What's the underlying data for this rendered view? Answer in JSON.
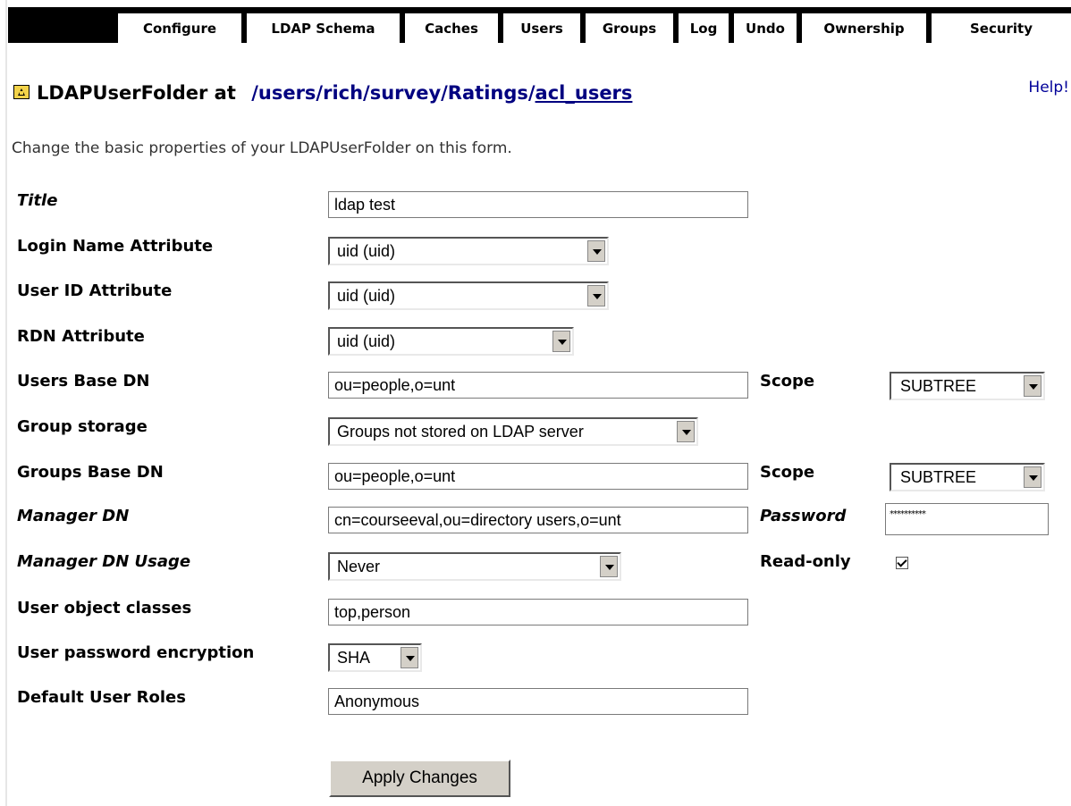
{
  "tabs": [
    {
      "label": "Configure",
      "active": true
    },
    {
      "label": "LDAP Schema"
    },
    {
      "label": "Caches"
    },
    {
      "label": "Users"
    },
    {
      "label": "Groups"
    },
    {
      "label": "Log"
    },
    {
      "label": "Undo"
    },
    {
      "label": "Ownership"
    },
    {
      "label": "Security"
    }
  ],
  "header": {
    "prefix": "LDAPUserFolder at",
    "path_plain": "/users/rich/survey/Ratings/",
    "path_link": "acl_users",
    "help": "Help!"
  },
  "intro": "Change the basic properties of your LDAPUserFolder on this form.",
  "form": {
    "title": {
      "label": "Title",
      "value": "ldap test"
    },
    "login_name_attribute": {
      "label": "Login Name Attribute",
      "value": "uid (uid)"
    },
    "user_id_attribute": {
      "label": "User ID Attribute",
      "value": "uid (uid)"
    },
    "rdn_attribute": {
      "label": "RDN Attribute",
      "value": "uid (uid)"
    },
    "users_base_dn": {
      "label": "Users Base DN",
      "value": "ou=people,o=unt",
      "scope_label": "Scope",
      "scope_value": "SUBTREE"
    },
    "group_storage": {
      "label": "Group storage",
      "value": "Groups not stored on LDAP server"
    },
    "groups_base_dn": {
      "label": "Groups Base DN",
      "value": "ou=people,o=unt",
      "scope_label": "Scope",
      "scope_value": "SUBTREE"
    },
    "manager_dn": {
      "label": "Manager DN",
      "value": "cn=courseeval,ou=directory users,o=unt",
      "password_label": "Password",
      "password_value": "**********"
    },
    "manager_dn_usage": {
      "label": "Manager DN Usage",
      "value": "Never",
      "readonly_label": "Read-only",
      "readonly_checked": true
    },
    "user_object_classes": {
      "label": "User object classes",
      "value": "top,person"
    },
    "user_password_encryption": {
      "label": "User password encryption",
      "value": "SHA"
    },
    "default_user_roles": {
      "label": "Default User Roles",
      "value": "Anonymous"
    }
  },
  "apply_button": "Apply Changes"
}
